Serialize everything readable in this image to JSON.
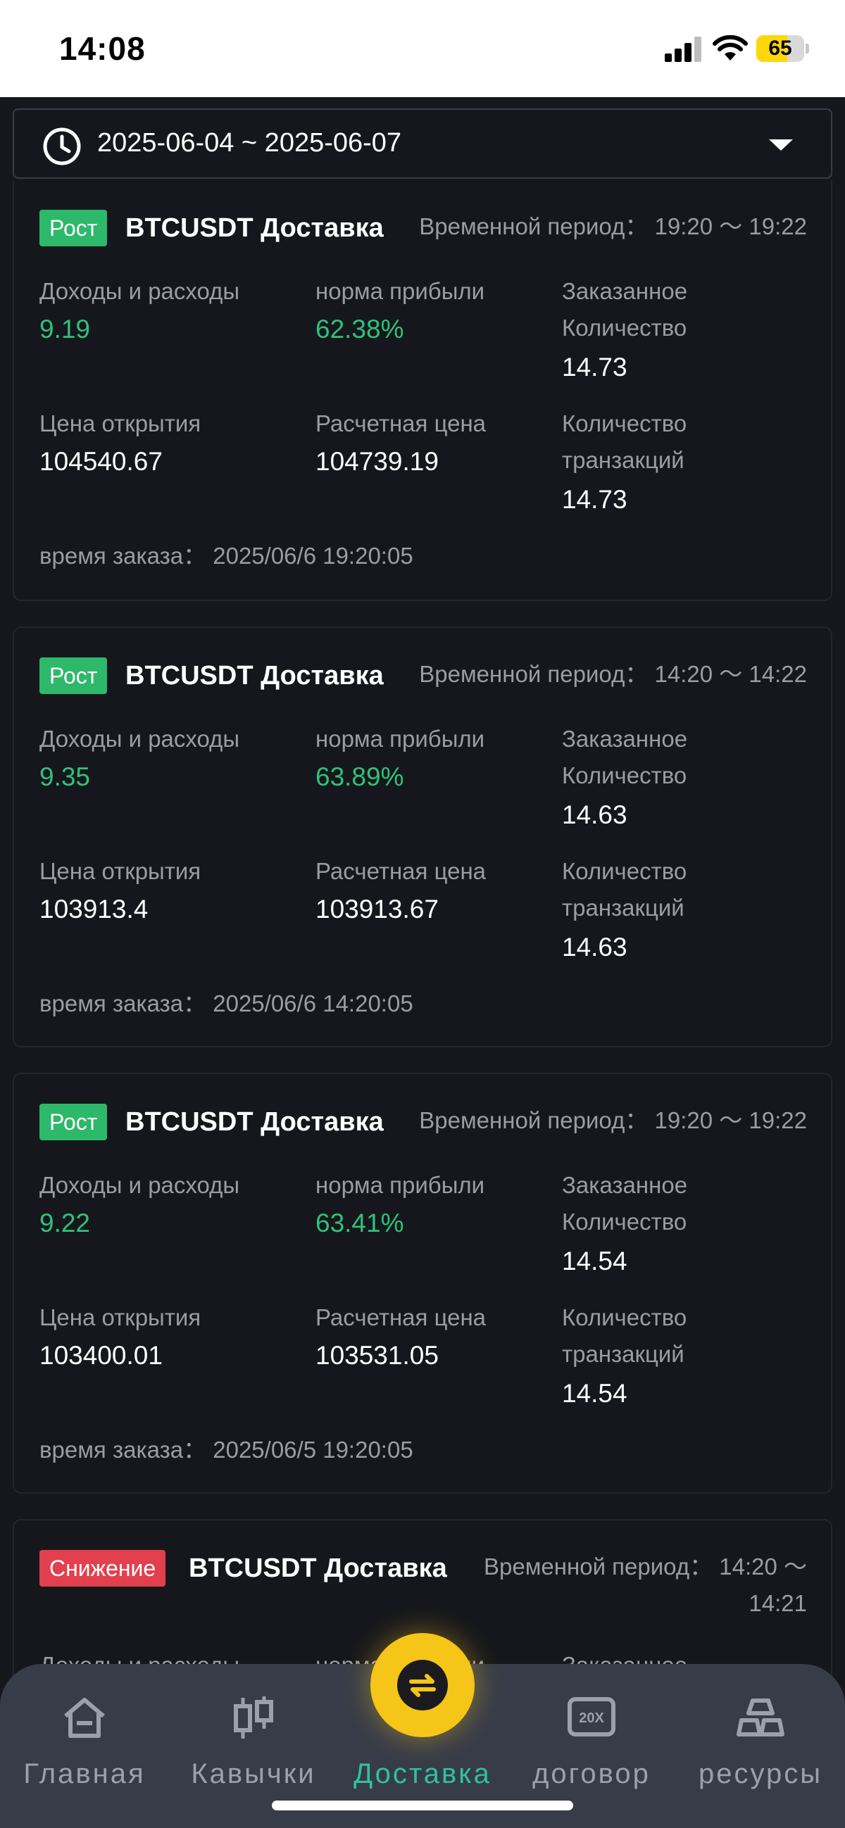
{
  "status_bar": {
    "time": "14:08",
    "battery": "65",
    "battery_level": 0.65
  },
  "date_filter": {
    "range": "2025-06-04 ~ 2025-06-07"
  },
  "labels": {
    "pnl": "Доходы и расходы",
    "profit_rate": "норма прибыли",
    "ordered_qty_1": "Заказанное",
    "ordered_qty_2": "Количество",
    "open_price": "Цена открытия",
    "settle_price": "Расчетная цена",
    "tx_qty_1": "Количество",
    "tx_qty_2": "транзакций"
  },
  "orders": [
    {
      "direction": "Рост",
      "direction_type": "up",
      "symbol": "BTCUSDT Доставка",
      "period": "Временной период： 19:20 ～ 19:22",
      "pnl": "9.19",
      "profit_rate": "62.38%",
      "ordered_qty": "14.73",
      "open_price": "104540.67",
      "settle_price": "104739.19",
      "tx_qty": "14.73",
      "order_time": "время заказа： 2025/06/6 19:20:05"
    },
    {
      "direction": "Рост",
      "direction_type": "up",
      "symbol": "BTCUSDT Доставка",
      "period": "Временной период： 14:20 ～ 14:22",
      "pnl": "9.35",
      "profit_rate": "63.89%",
      "ordered_qty": "14.63",
      "open_price": "103913.4",
      "settle_price": "103913.67",
      "tx_qty": "14.63",
      "order_time": "время заказа： 2025/06/6 14:20:05"
    },
    {
      "direction": "Рост",
      "direction_type": "up",
      "symbol": "BTCUSDT Доставка",
      "period": "Временной период： 19:20 ～ 19:22",
      "pnl": "9.22",
      "profit_rate": "63.41%",
      "ordered_qty": "14.54",
      "open_price": "103400.01",
      "settle_price": "103531.05",
      "tx_qty": "14.54",
      "order_time": "время заказа： 2025/06/5 19:20:05"
    },
    {
      "direction": "Снижение",
      "direction_type": "down",
      "symbol": "BTCUSDT Доставка",
      "period_line1": "Временной период： 14:20 ～",
      "period_line2": "14:21"
    }
  ],
  "nav": [
    {
      "label": "Главная",
      "icon": "home-icon"
    },
    {
      "label": "Кавычки",
      "icon": "candlestick-icon"
    },
    {
      "label": "Доставка",
      "icon": "swap-icon",
      "active": true
    },
    {
      "label": "договор",
      "icon": "contract-20x-icon"
    },
    {
      "label": "ресурсы",
      "icon": "assets-icon"
    }
  ],
  "colors": {
    "up": "#2db86a",
    "down": "#e2404e",
    "accent": "#f5c518",
    "active_nav": "#2ec2a0",
    "background": "#16171c"
  }
}
